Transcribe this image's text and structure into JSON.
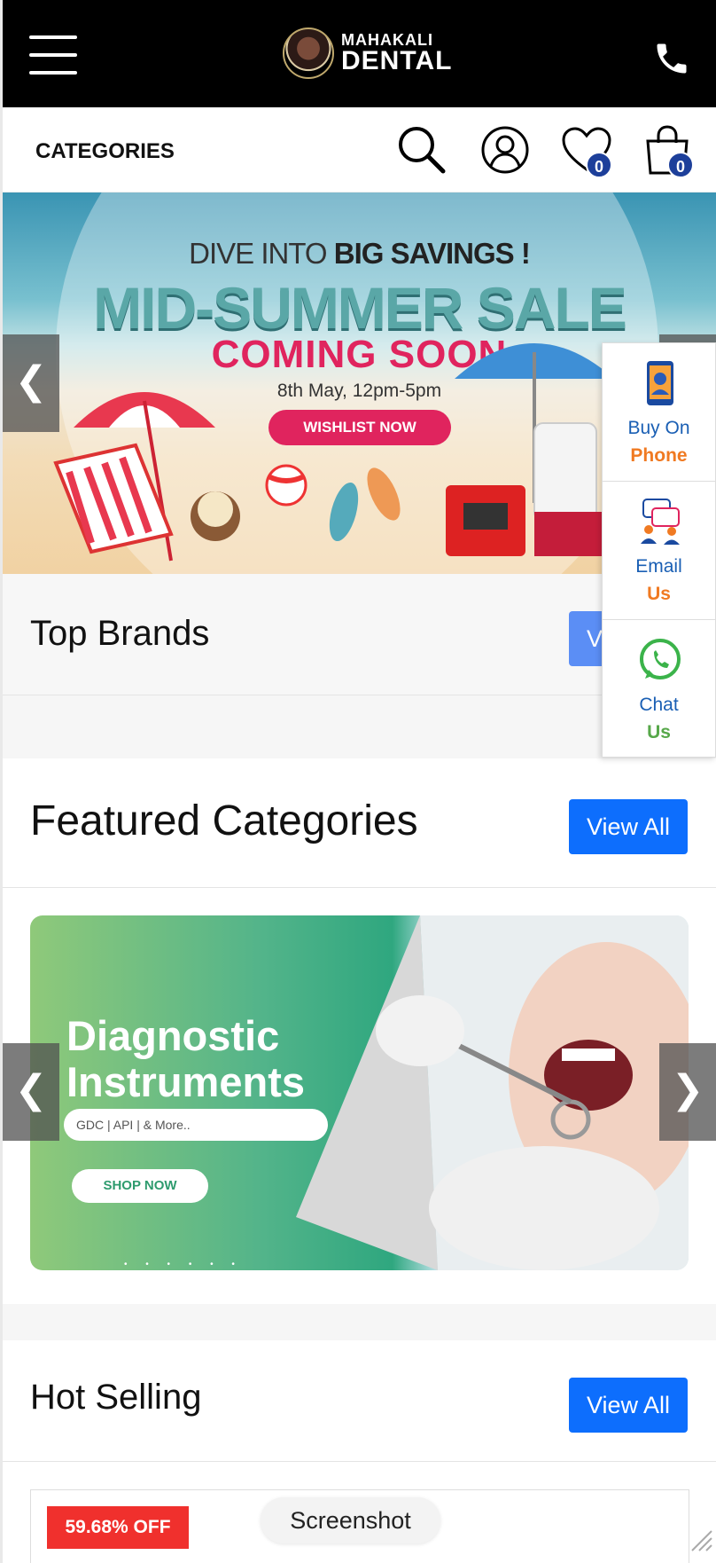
{
  "header": {
    "logo_line1": "MAHAKALI",
    "logo_line2": "DENTAL"
  },
  "nav": {
    "categories_label": "CATEGORIES",
    "wishlist_count": "0",
    "cart_count": "0"
  },
  "hero": {
    "line1_prefix": "DIVE INTO",
    "line1_bold": "BIG SAVINGS !",
    "line2": "MID-SUMMER SALE",
    "line3": "COMING SOON",
    "line4": "8th May, 12pm-5pm",
    "button": "WISHLIST NOW",
    "prev": "❮",
    "next": "❯"
  },
  "contact": {
    "phone_l1": "Buy On",
    "phone_l2": "Phone",
    "email_l1": "Email",
    "email_l2": "Us",
    "chat_l1": "Chat",
    "chat_l2": "Us",
    "colors": {
      "link": "#1a5fb4",
      "orange": "#f07a22",
      "green": "#57a84a"
    }
  },
  "sections": {
    "top_brands": {
      "title": "Top Brands",
      "view_all": "View All"
    },
    "featured": {
      "title": "Featured Categories",
      "view_all": "View All"
    },
    "hot_selling": {
      "title": "Hot Selling",
      "view_all": "View All"
    }
  },
  "featured_banner": {
    "title_line1": "Diagnostic",
    "title_line2": "Instruments",
    "tag": "GDC | API | & More..",
    "button": "SHOP NOW",
    "dots": "• • • • • •",
    "prev": "❮",
    "next": "❯"
  },
  "product": {
    "discount": "59.68% OFF"
  },
  "overlay": {
    "screenshot_label": "Screenshot"
  },
  "theme": {
    "accent": "#0d6efd",
    "header_bg": "#000000",
    "badge_bg": "#1d3f9a",
    "sale_red": "#f0302d"
  }
}
